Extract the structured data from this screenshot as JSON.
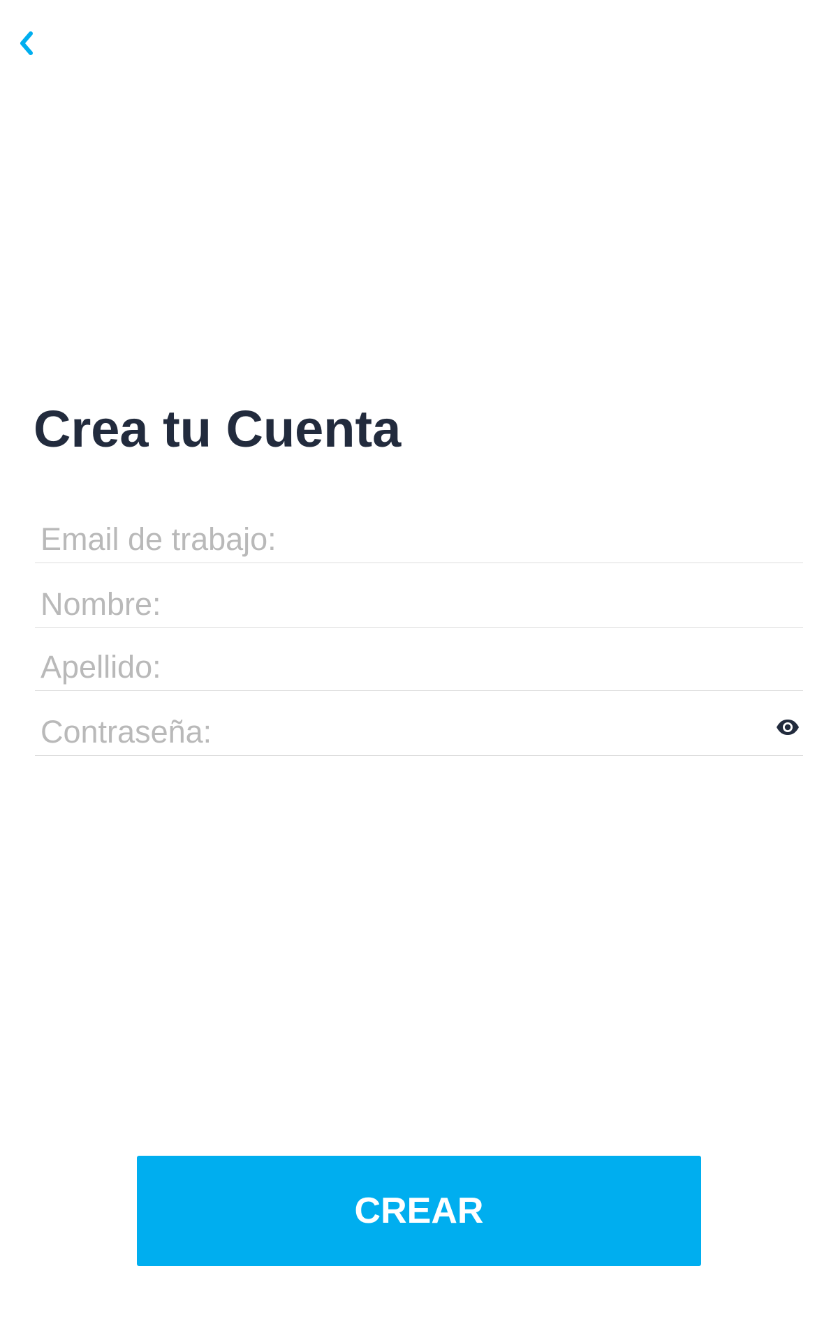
{
  "header": {
    "back_icon": "chevron-left-icon"
  },
  "page": {
    "title": "Crea tu Cuenta"
  },
  "form": {
    "email": {
      "placeholder": "Email de trabajo:",
      "value": ""
    },
    "nombre": {
      "placeholder": "Nombre:",
      "value": ""
    },
    "apellido": {
      "placeholder": "Apellido:",
      "value": ""
    },
    "password": {
      "placeholder": "Contraseña:",
      "value": "",
      "toggle_icon": "eye-icon"
    }
  },
  "actions": {
    "create_label": "CREAR"
  },
  "colors": {
    "accent": "#00aeef",
    "title": "#222b3d",
    "placeholder": "#b9b9b9",
    "divider": "#dedede",
    "icon_dark": "#222b3d"
  }
}
